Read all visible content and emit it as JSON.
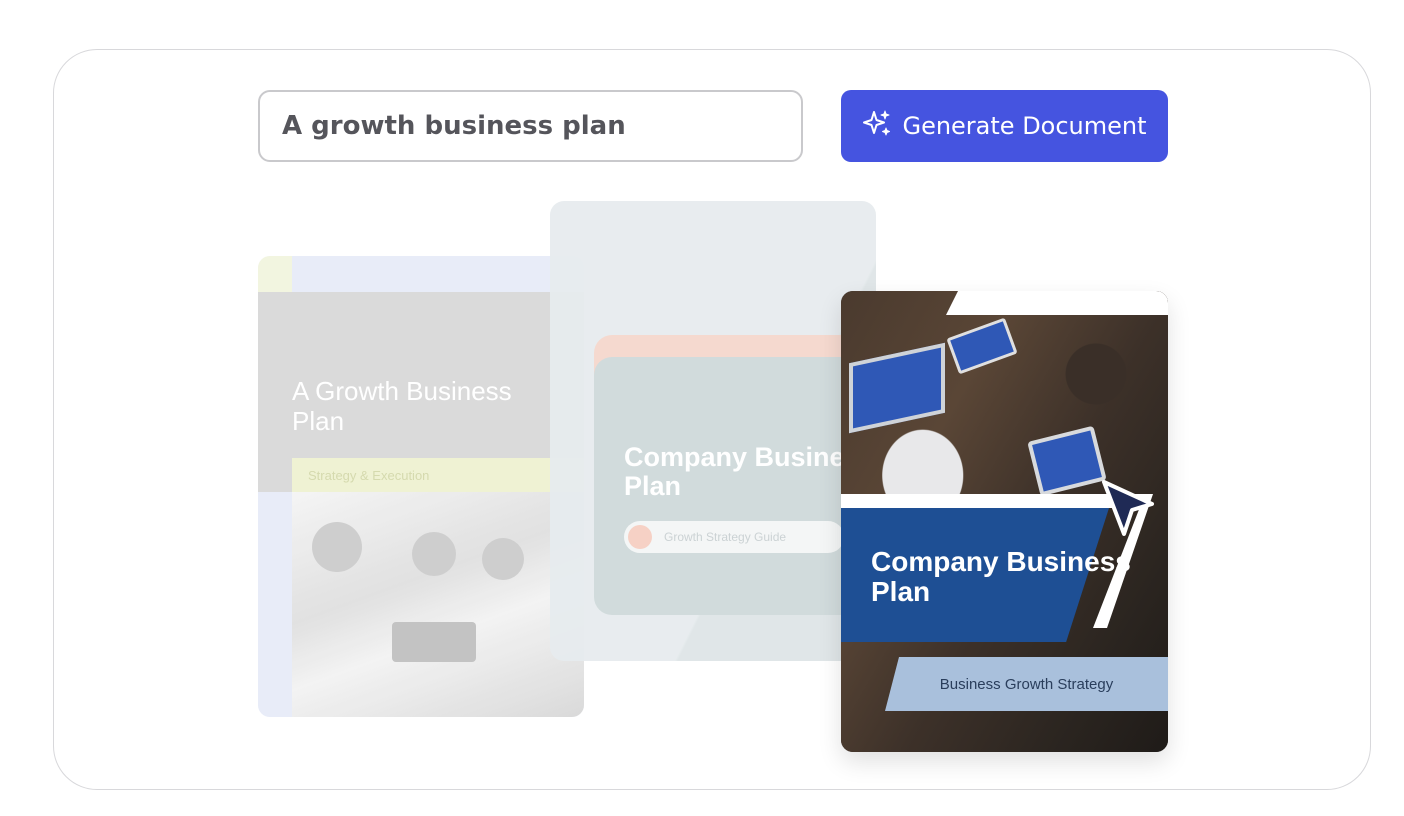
{
  "prompt": {
    "value": "A growth business plan"
  },
  "generate_button": {
    "label": "Generate Document",
    "icon": "sparkle-icon",
    "color": "#4554e0"
  },
  "cards": {
    "left": {
      "title": "A Growth Business Plan",
      "subtitle": "Strategy & Execution"
    },
    "middle": {
      "title": "Company Business Plan",
      "subtitle": "Growth Strategy Guide"
    },
    "right": {
      "title": "Company Business Plan",
      "subtitle": "Business Growth Strategy",
      "accent": "#1e4f94"
    }
  }
}
